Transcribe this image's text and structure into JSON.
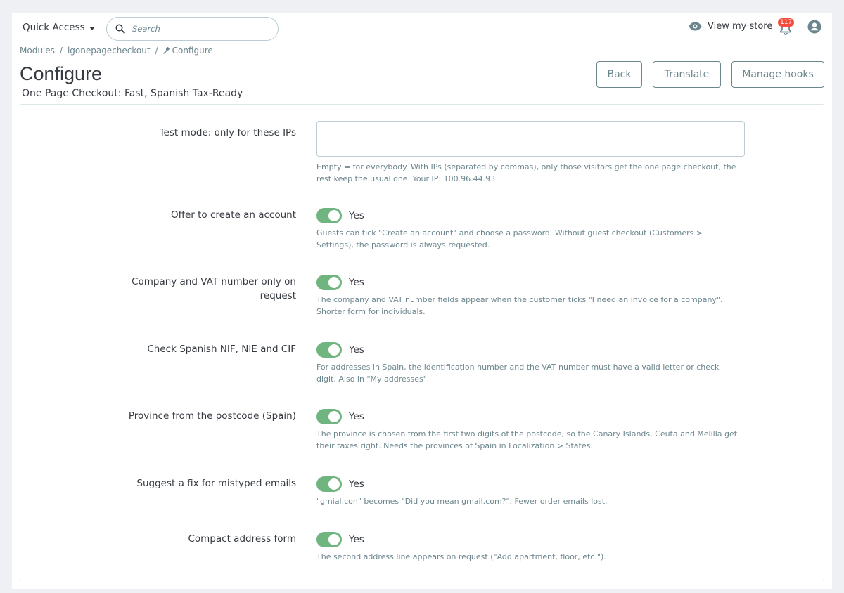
{
  "header": {
    "quick_access": "Quick Access",
    "search_placeholder": "Search",
    "view_store": "View my store",
    "notification_count": "117"
  },
  "breadcrumb": [
    "Modules",
    "lgonepagecheckout",
    "Configure"
  ],
  "page": {
    "title": "Configure",
    "subtitle": "One Page Checkout: Fast, Spanish Tax-Ready"
  },
  "toolbar": {
    "back": "Back",
    "translate": "Translate",
    "manage_hooks": "Manage hooks"
  },
  "form": {
    "test_mode": {
      "label": "Test mode: only for these IPs",
      "value": "",
      "help": "Empty = for everybody. With IPs (separated by commas), only those visitors get the one page checkout, the rest keep the usual one. Your IP: 100.96.44.93"
    },
    "options": [
      {
        "label": "Offer to create an account",
        "state": "Yes",
        "help": "Guests can tick \"Create an account\" and choose a password. Without guest checkout (Customers > Settings), the password is always requested."
      },
      {
        "label": "Company and VAT number only on request",
        "state": "Yes",
        "help": "The company and VAT number fields appear when the customer ticks \"I need an invoice for a company\". Shorter form for individuals."
      },
      {
        "label": "Check Spanish NIF, NIE and CIF",
        "state": "Yes",
        "help": "For addresses in Spain, the identification number and the VAT number must have a valid letter or check digit. Also in \"My addresses\"."
      },
      {
        "label": "Province from the postcode (Spain)",
        "state": "Yes",
        "help": "The province is chosen from the first two digits of the postcode, so the Canary Islands, Ceuta and Melilla get their taxes right. Needs the provinces of Spain in Localization > States."
      },
      {
        "label": "Suggest a fix for mistyped emails",
        "state": "Yes",
        "help": "\"gmial.con\" becomes \"Did you mean gmail.com?\". Fewer order emails lost."
      },
      {
        "label": "Compact address form",
        "state": "Yes",
        "help": "The second address line appears on request (\"Add apartment, floor, etc.\")."
      }
    ]
  },
  "colors": {
    "toggle_on": "#70b580",
    "badge": "#f54c3e",
    "muted_text": "#6c868e"
  }
}
